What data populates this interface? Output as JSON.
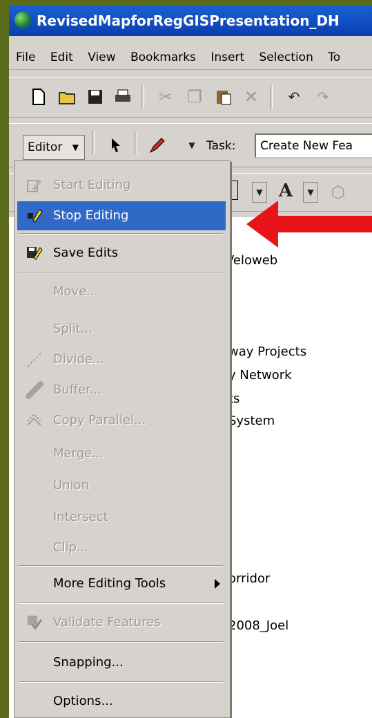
{
  "window": {
    "title": "RevisedMapforRegGISPresentation_DH"
  },
  "menubar": [
    "File",
    "Edit",
    "View",
    "Bookmarks",
    "Insert",
    "Selection",
    "To"
  ],
  "toolbar": {
    "editor_label": "Editor",
    "task_label": "Task:",
    "task_value": "Create New Fea"
  },
  "toc": [
    "Veloweb",
    "way Projects",
    "y Network",
    "ts",
    "System",
    "orridor",
    "2008_Joel"
  ],
  "editor_menu": {
    "items": [
      {
        "label": "Start Editing",
        "icon": "start-editing-icon",
        "disabled": true
      },
      {
        "label": "Stop Editing",
        "icon": "stop-editing-icon",
        "selected": true
      },
      {
        "label": "Save Edits",
        "icon": "save-edits-icon"
      },
      {
        "label": "Move...",
        "disabled": true
      },
      {
        "label": "Split...",
        "disabled": true
      },
      {
        "label": "Divide...",
        "icon": "divide-icon",
        "disabled": true
      },
      {
        "label": "Buffer...",
        "icon": "buffer-icon",
        "disabled": true
      },
      {
        "label": "Copy Parallel...",
        "icon": "copy-parallel-icon",
        "disabled": true
      },
      {
        "label": "Merge...",
        "disabled": true
      },
      {
        "label": "Union",
        "disabled": true
      },
      {
        "label": "Intersect",
        "disabled": true
      },
      {
        "label": "Clip...",
        "disabled": true
      },
      {
        "label": "More Editing Tools",
        "submenu": true
      },
      {
        "label": "Validate Features",
        "icon": "validate-features-icon",
        "disabled": true
      },
      {
        "label": "Snapping..."
      },
      {
        "label": "Options..."
      }
    ]
  },
  "colors": {
    "selection": "#3169c6",
    "annotation_arrow": "#e8141a",
    "background": "#5a6b1c"
  }
}
